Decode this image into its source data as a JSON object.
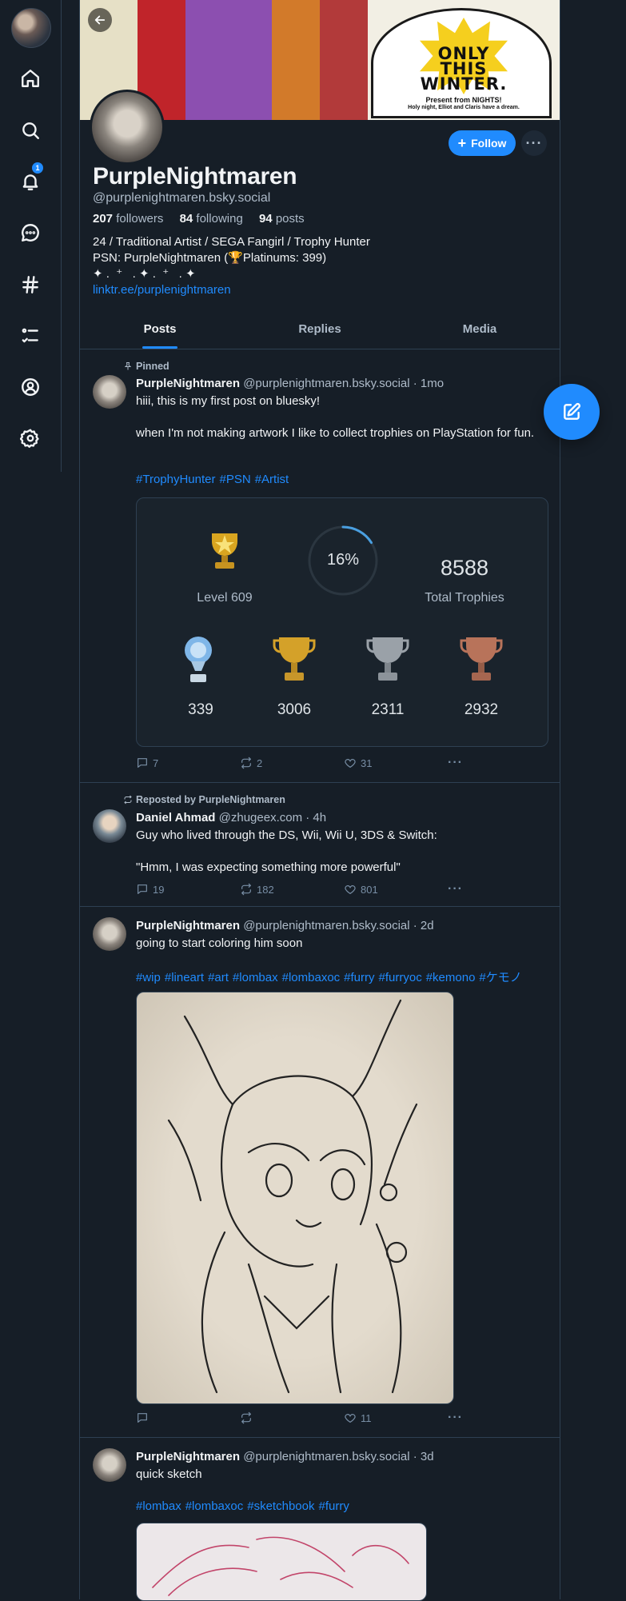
{
  "nav": {
    "notifications_badge": "1"
  },
  "banner": {
    "line1": "ONLY",
    "line2": "THIS",
    "line3": "WINTER.",
    "sub1": "Present from NIGHTS!",
    "sub2": "Holy night, Elliot and Claris have a dream."
  },
  "profile": {
    "display_name": "PurpleNightmaren",
    "handle": "@purplenightmaren.bsky.social",
    "followers_count": "207",
    "followers_label": "followers",
    "following_count": "84",
    "following_label": "following",
    "posts_count": "94",
    "posts_label": "posts",
    "bio_line1": "24 / Traditional Artist / SEGA Fangirl / Trophy Hunter",
    "bio_line2": "PSN: PurpleNightmaren (🏆Platinums: 399)",
    "bio_line3": "✦ .  ⁺   . ✦ .  ⁺   . ✦",
    "link": "linktr.ee/purplenightmaren",
    "follow_label": "Follow",
    "more_label": "···"
  },
  "tabs": [
    {
      "label": "Posts"
    },
    {
      "label": "Replies"
    },
    {
      "label": "Media"
    }
  ],
  "posts": [
    {
      "context": "Pinned",
      "author": "PurpleNightmaren",
      "handle": "@purplenightmaren.bsky.social",
      "time": "· 1mo",
      "text": "hiii, this is my first post on bluesky!\n\nwhen I'm not making artwork I like to collect trophies on PlayStation for fun.",
      "tags": [
        "#TrophyHunter",
        "#PSN",
        "#Artist"
      ],
      "trophy_card": {
        "level_label": "Level 609",
        "progress_text": "16%",
        "progress": 0.16,
        "total": "8588",
        "total_label": "Total Trophies",
        "platinum": "339",
        "gold": "3006",
        "silver": "2311",
        "bronze": "2932"
      },
      "replies": "7",
      "reposts": "2",
      "likes": "31"
    },
    {
      "context": "Reposted by PurpleNightmaren",
      "author": "Daniel Ahmad",
      "handle": "@zhugeex.com",
      "time": "· 4h",
      "text": "Guy who lived through the DS, Wii, Wii U, 3DS & Switch:\n\n\"Hmm, I was expecting something more powerful\"",
      "replies": "19",
      "reposts": "182",
      "likes": "801"
    },
    {
      "author": "PurpleNightmaren",
      "handle": "@purplenightmaren.bsky.social",
      "time": "· 2d",
      "text": "going to start coloring him soon",
      "tags": [
        "#wip",
        "#lineart",
        "#art",
        "#lombax",
        "#lombaxoc",
        "#furry",
        "#furryoc",
        "#kemono",
        "#ケモノ"
      ],
      "replies": "",
      "reposts": "",
      "likes": "11"
    },
    {
      "author": "PurpleNightmaren",
      "handle": "@purplenightmaren.bsky.social",
      "time": "· 3d",
      "text": "quick sketch",
      "tags": [
        "#lombax",
        "#lombaxoc",
        "#sketchbook",
        "#furry"
      ]
    }
  ],
  "colors": {
    "background": "#161e27",
    "accent": "#208bfe",
    "border": "#2e4052",
    "muted_text": "#aebbc9"
  }
}
